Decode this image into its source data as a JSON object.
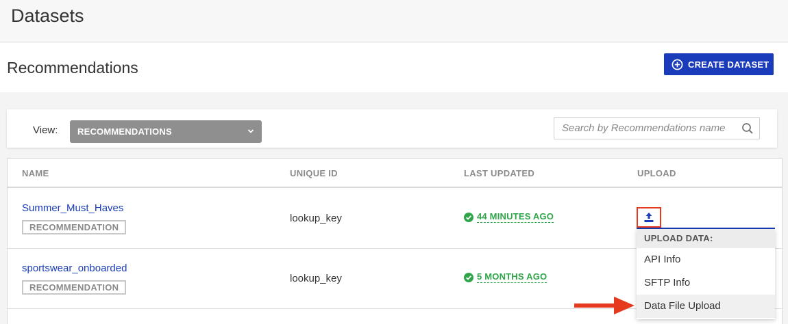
{
  "page": {
    "title": "Datasets"
  },
  "header": {
    "section_title": "Recommendations",
    "create_button": "CREATE DATASET"
  },
  "filter": {
    "view_label": "View:",
    "view_selected": "RECOMMENDATIONS",
    "search_placeholder": "Search by Recommendations name"
  },
  "table": {
    "columns": [
      "NAME",
      "UNIQUE ID",
      "LAST UPDATED",
      "UPLOAD"
    ],
    "rows": [
      {
        "name": "Summer_Must_Haves",
        "type": "RECOMMENDATION",
        "unique_id": "lookup_key",
        "last_updated": "44 MINUTES AGO"
      },
      {
        "name": "sportswear_onboarded",
        "type": "RECOMMENDATION",
        "unique_id": "lookup_key",
        "last_updated": "5 MONTHS AGO"
      }
    ]
  },
  "upload_menu": {
    "header": "UPLOAD DATA:",
    "items": [
      "API Info",
      "SFTP Info",
      "Data File Upload"
    ]
  },
  "colors": {
    "primary": "#1a3cba",
    "success": "#2fa54a",
    "highlight": "#e53a1e"
  },
  "icons": [
    "plus-circle-icon",
    "chevron-down-icon",
    "search-icon",
    "check-circle-icon",
    "upload-icon",
    "arrow-right-icon"
  ]
}
